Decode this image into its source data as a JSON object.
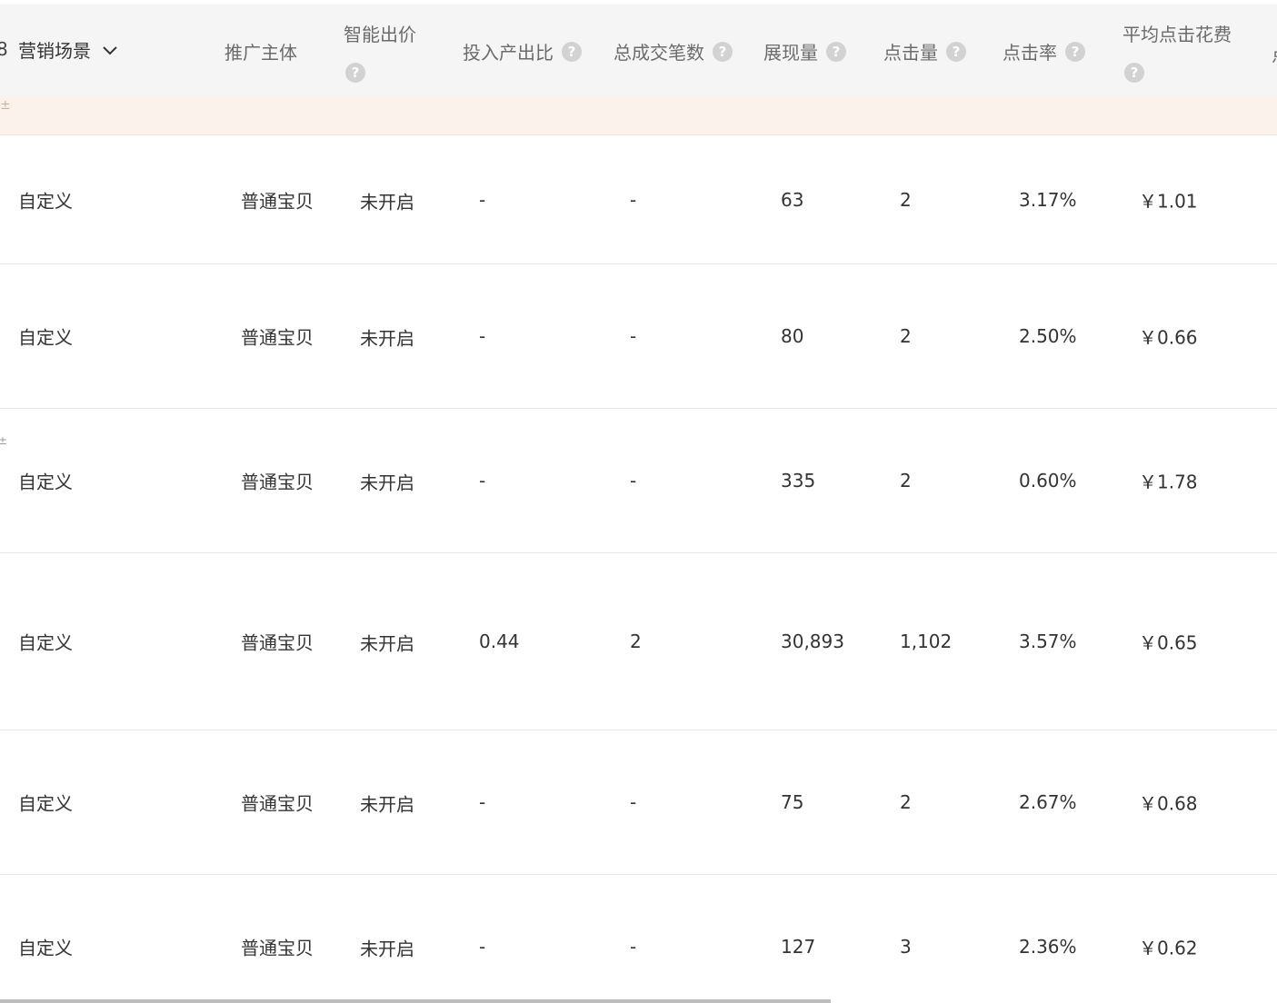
{
  "columns": {
    "scene": "营销场景",
    "subject": "推广主体",
    "smart_bid": "智能出价",
    "roi": "投入产出比",
    "orders": "总成交笔数",
    "impressions": "展现量",
    "clicks": "点击量",
    "ctr": "点击率",
    "avg_cpc": "平均点击花费"
  },
  "help_glyph": "?",
  "rows": [
    {
      "scene": "自定义",
      "subject": "普通宝贝",
      "smart_bid": "未开启",
      "roi": "-",
      "orders": "-",
      "impressions": "63",
      "clicks": "2",
      "ctr": "3.17%",
      "avg_cpc": "￥1.01"
    },
    {
      "scene": "自定义",
      "subject": "普通宝贝",
      "smart_bid": "未开启",
      "roi": "-",
      "orders": "-",
      "impressions": "80",
      "clicks": "2",
      "ctr": "2.50%",
      "avg_cpc": "￥0.66"
    },
    {
      "scene": "自定义",
      "subject": "普通宝贝",
      "smart_bid": "未开启",
      "roi": "-",
      "orders": "-",
      "impressions": "335",
      "clicks": "2",
      "ctr": "0.60%",
      "avg_cpc": "￥1.78"
    },
    {
      "scene": "自定义",
      "subject": "普通宝贝",
      "smart_bid": "未开启",
      "roi": "0.44",
      "orders": "2",
      "impressions": "30,893",
      "clicks": "1,102",
      "ctr": "3.57%",
      "avg_cpc": "￥0.65"
    },
    {
      "scene": "自定义",
      "subject": "普通宝贝",
      "smart_bid": "未开启",
      "roi": "-",
      "orders": "-",
      "impressions": "75",
      "clicks": "2",
      "ctr": "2.67%",
      "avg_cpc": "￥0.68"
    },
    {
      "scene": "自定义",
      "subject": "普通宝贝",
      "smart_bid": "未开启",
      "roi": "-",
      "orders": "-",
      "impressions": "127",
      "clicks": "3",
      "ctr": "2.36%",
      "avg_cpc": "￥0.62"
    }
  ],
  "colors": {
    "header_bg": "#f5f5f5",
    "banner_bg": "#fcf2ec",
    "divider": "#e8e8e8",
    "help_icon": "#d2d2d2"
  }
}
